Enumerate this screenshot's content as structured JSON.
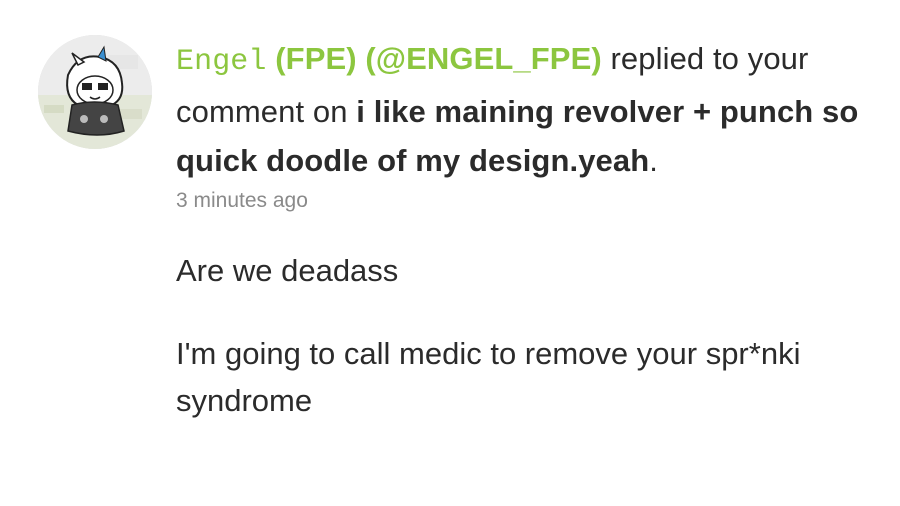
{
  "notification": {
    "avatar_icon": "user-avatar",
    "username": "Engel",
    "display_name": "(FPE) (@ENGEL_FPE)",
    "action_text": "replied to your comment on",
    "post_title": "i like maining revolver + punch so quick doodle of my design.yeah",
    "trailing_punct": ".",
    "timestamp": "3 minutes ago",
    "reply_lines": [
      "Are we deadass",
      "I'm going to call medic to remove your spr*nki syndrome"
    ],
    "accent_color": "#8cc63f"
  }
}
